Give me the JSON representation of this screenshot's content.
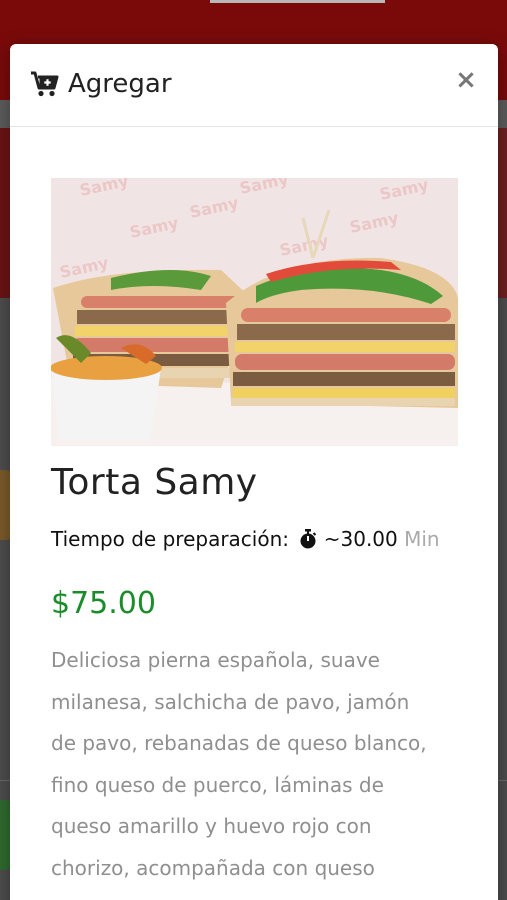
{
  "modal": {
    "title": "Agregar",
    "header_icon": "cart-plus-icon",
    "close_symbol": "×",
    "close_icon": "close-icon"
  },
  "product": {
    "name": "Torta Samy",
    "image_icon": "sandwich-photo",
    "prep_label": "Tiempo de preparación:",
    "prep_icon": "stopwatch-icon",
    "prep_time": "~30.00",
    "prep_unit": "Min",
    "price": "$75.00",
    "description": "Deliciosa pierna española, suave\nmilanesa, salchicha de pavo, jamón\nde pavo, rebanadas de queso blanco,\nfino queso de puerco, láminas de\nqueso amarillo y huevo rojo con\nchorizo, acompañada con queso"
  },
  "colors": {
    "price": "#1a8c2a",
    "unit_muted": "#aaaaaa",
    "description": "#8f8f8f",
    "overlay_header": "#7a0a0a"
  }
}
